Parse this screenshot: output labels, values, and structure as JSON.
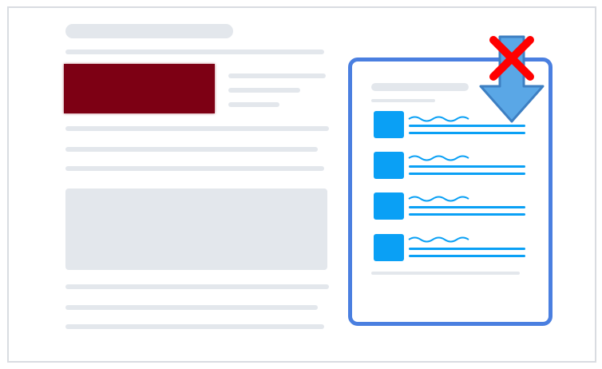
{
  "figure": {
    "colors": {
      "frame_border": "#d9dce1",
      "placeholder_gray": "#e3e7ec",
      "image_block": "#7d0014",
      "card_border": "#4a7fe0",
      "list_blue": "#0aa0f5",
      "arrow_fill": "#5aa7e6",
      "arrow_stroke": "#3d7fc2",
      "cross": "#ff0000"
    },
    "left_page": {
      "text_lines_before_box": 4,
      "text_lines_after_box": 3,
      "has_image_block": true,
      "has_content_box": true
    },
    "sidebar_card": {
      "list_item_count": 4,
      "list_item_icon": "square-icon",
      "list_item_text": "wavy-line-and-two-lines"
    },
    "arrow": {
      "icon": "down-arrow-icon",
      "crossed_out": true
    },
    "cross": {
      "icon": "x-icon"
    }
  }
}
